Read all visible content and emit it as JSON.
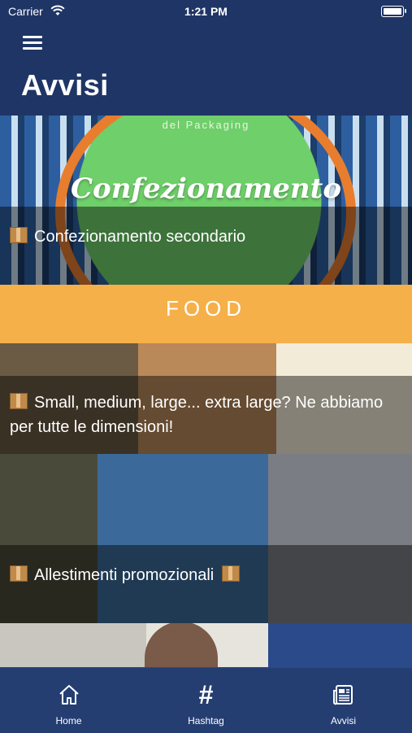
{
  "status_bar": {
    "carrier": "Carrier",
    "time": "1:21 PM"
  },
  "header": {
    "title": "Avvisi"
  },
  "feed": {
    "cards": [
      {
        "title": "Confezionamento secondario",
        "image_text": {
          "small": "del Packaging",
          "brand": "Confezionamento"
        }
      },
      {
        "title": "Small, medium, large... extra large? Ne abbiamo per tutte le dimensioni!",
        "image_text": {
          "banner": "FOOD"
        }
      },
      {
        "title": "Allestimenti promozionali"
      },
      {
        "title": ""
      }
    ]
  },
  "tab_bar": {
    "tabs": [
      {
        "label": "Home",
        "icon": "home-icon"
      },
      {
        "label": "Hashtag",
        "icon": "hashtag-icon"
      },
      {
        "label": "Avvisi",
        "icon": "news-icon"
      }
    ]
  },
  "colors": {
    "navy": "#1f3566",
    "tab_bar": "#253e72"
  }
}
